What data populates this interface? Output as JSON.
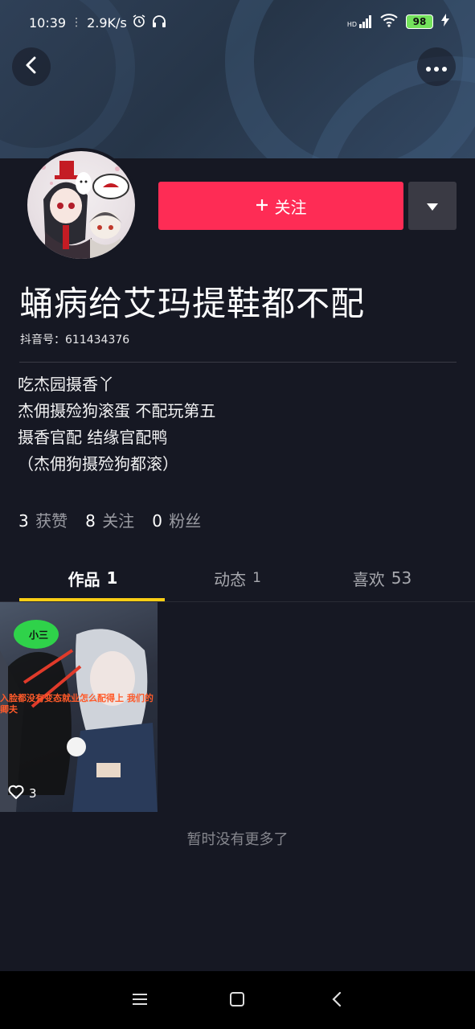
{
  "status_bar": {
    "time": "10:39",
    "speed": "2.9K/s",
    "network": "HD",
    "battery": "98"
  },
  "header": {
    "back_icon": "chevron-left-icon",
    "more_icon": "ellipsis-icon"
  },
  "profile": {
    "follow_label": "关注",
    "nickname": "蛹病给艾玛提鞋都不配",
    "douyin_id": "抖音号：611434376",
    "bio": [
      "吃杰园摄香丫",
      "杰佣摄殓狗滚蛋 不配玩第五",
      "摄香官配 结缘官配鸭",
      "（杰佣狗摄殓狗都滚）"
    ]
  },
  "stats": [
    {
      "num": "3",
      "label": "获赞"
    },
    {
      "num": "8",
      "label": "关注"
    },
    {
      "num": "0",
      "label": "粉丝"
    }
  ],
  "tabs": [
    {
      "label": "作品",
      "count": "1"
    },
    {
      "label": "动态",
      "count": "1"
    },
    {
      "label": "喜欢",
      "count": "53"
    }
  ],
  "videos": [
    {
      "likes": "3",
      "overlay_tag": "小三",
      "overlay_caption": "入脸都没有变态就业怎么配得上 我们的卿夫"
    }
  ],
  "footer": {
    "no_more": "暂时没有更多了"
  },
  "colors": {
    "background": "#161823",
    "follow_button": "#fe2c55",
    "tab_indicator": "#face15"
  }
}
